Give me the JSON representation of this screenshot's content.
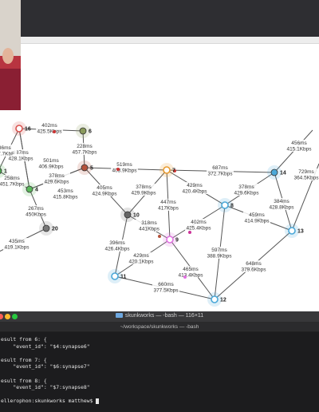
{
  "graph": {
    "nodes": [
      {
        "id": "16",
        "label": "16",
        "color": "#d9534f",
        "style": "ring"
      },
      {
        "id": "6",
        "label": "6",
        "color": "#8a9a5b",
        "style": "filled"
      },
      {
        "id": "1",
        "label": "1",
        "color": "#4caf50",
        "style": "filled"
      },
      {
        "id": "4",
        "label": "4",
        "color": "#5cb85c",
        "style": "filled"
      },
      {
        "id": "5",
        "label": "5",
        "color": "#b5523b",
        "style": "filled"
      },
      {
        "id": "7",
        "label": "7",
        "color": "#e89a2e",
        "style": "ring"
      },
      {
        "id": "14",
        "label": "14",
        "color": "#4aa8d8",
        "style": "filled"
      },
      {
        "id": "8",
        "label": "8",
        "color": "#4aa8d8",
        "style": "ring"
      },
      {
        "id": "10",
        "label": "10",
        "color": "#666666",
        "style": "filled"
      },
      {
        "id": "20",
        "label": "20",
        "color": "#777777",
        "style": "filled"
      },
      {
        "id": "9",
        "label": "9",
        "color": "#e070e0",
        "style": "ring"
      },
      {
        "id": "11",
        "label": "11",
        "color": "#4aa8d8",
        "style": "ring"
      },
      {
        "id": "12",
        "label": "12",
        "color": "#4aa8d8",
        "style": "ring"
      },
      {
        "id": "13",
        "label": "13",
        "color": "#4aa8d8",
        "style": "ring"
      }
    ],
    "edges": [
      {
        "from": "16",
        "to": "6",
        "latency": "402ms",
        "bandwidth": "425.5Kbps"
      },
      {
        "from": "16",
        "to": "4",
        "latency": "387ms",
        "bandwidth": "428.1Kbps"
      },
      {
        "from": "16",
        "to": "1",
        "latency": "336ms",
        "bandwidth": "417.7KbF"
      },
      {
        "from": "6",
        "to": "5",
        "latency": "228ms",
        "bandwidth": "457.7Kbps"
      },
      {
        "from": "5",
        "to": "4",
        "latency": "378ms",
        "bandwidth": "429.6Kbps"
      },
      {
        "from": "4",
        "to": "1",
        "latency": "258ms",
        "bandwidth": "451.7Kbps"
      },
      {
        "from": "4",
        "to": "16",
        "latency": "501ms",
        "bandwidth": "406.9Kbps"
      },
      {
        "from": "5",
        "to": "7",
        "latency": "519ms",
        "bandwidth": "403.9Kbps"
      },
      {
        "from": "5",
        "to": "10",
        "latency": "405ms",
        "bandwidth": "424.9Kbps"
      },
      {
        "from": "5",
        "to": "4",
        "latency": "453ms",
        "bandwidth": "415.8Kbps"
      },
      {
        "from": "4",
        "to": "20",
        "latency": "267ms",
        "bandwidth": "450Kbps"
      },
      {
        "from": "20",
        "to": "off",
        "latency": "435ms",
        "bandwidth": "419.1Kbps"
      },
      {
        "from": "7",
        "to": "14",
        "latency": "687ms",
        "bandwidth": "372.7Kbps"
      },
      {
        "from": "7",
        "to": "10",
        "latency": "378ms",
        "bandwidth": "429.9Kbps"
      },
      {
        "from": "7",
        "to": "9",
        "latency": "447ms",
        "bandwidth": "417Kbps"
      },
      {
        "from": "7",
        "to": "8",
        "latency": "429ms",
        "bandwidth": "420.4Kbps"
      },
      {
        "from": "14",
        "to": "8",
        "latency": "378ms",
        "bandwidth": "429.6Kbps"
      },
      {
        "from": "14",
        "to": "13",
        "latency": "384ms",
        "bandwidth": "428.8Kbps"
      },
      {
        "from": "14",
        "to": "off2",
        "latency": "729ms",
        "bandwidth": "364.5Kbps"
      },
      {
        "from": "13",
        "to": "off3",
        "latency": "456ms",
        "bandwidth": "415.1Kbps"
      },
      {
        "from": "8",
        "to": "13",
        "latency": "459ms",
        "bandwidth": "414.9Kbps"
      },
      {
        "from": "8",
        "to": "9",
        "latency": "402ms",
        "bandwidth": "425.4Kbps"
      },
      {
        "from": "8",
        "to": "12",
        "latency": "597ms",
        "bandwidth": "388.9Kbps"
      },
      {
        "from": "10",
        "to": "9",
        "latency": "318ms",
        "bandwidth": "441Kbps"
      },
      {
        "from": "10",
        "to": "11",
        "latency": "396ms",
        "bandwidth": "426.4Kbps"
      },
      {
        "from": "9",
        "to": "11",
        "latency": "429ms",
        "bandwidth": "420.1Kbps"
      },
      {
        "from": "9",
        "to": "12",
        "latency": "465ms",
        "bandwidth": "413.4Kbps"
      },
      {
        "from": "11",
        "to": "12",
        "latency": "660ms",
        "bandwidth": "377.5Kbps"
      },
      {
        "from": "12",
        "to": "13",
        "latency": "648ms",
        "bandwidth": "379.6Kbps"
      }
    ]
  },
  "terminal": {
    "title": "skunkworks — -bash — 116×11",
    "path": "~/workspace/skunkworks — -bash",
    "lines": [
      "esult from 6: {",
      "    \"event_id\": \"$4:synapse6\"",
      "",
      "esult from 7: {",
      "    \"event_id\": \"$6:synapse7\"",
      "",
      "esult from 8: {",
      "    \"event_id\": \"$7:synapse8\"",
      "",
      "ellerophon:skunkworks matthew$ "
    ]
  }
}
